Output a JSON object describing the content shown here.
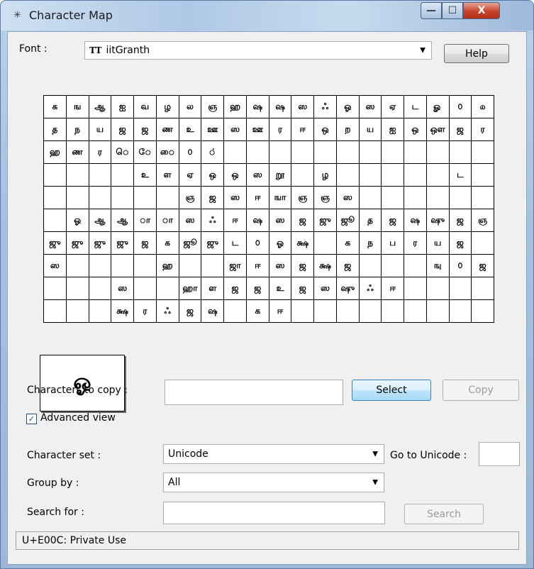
{
  "window": {
    "title": "Character Map",
    "buttons": {
      "minimize": "—",
      "maximize": "☐",
      "close": "X"
    }
  },
  "font": {
    "label": "Font :",
    "value": "iitGranth",
    "icon": "TT"
  },
  "help_label": "Help",
  "grid_rows": [
    [
      "க",
      "ங",
      "ஆ",
      "ஐ",
      "வ",
      "ழ",
      "ல",
      "ஞ",
      "ஹ",
      "ஷ",
      "ஷ",
      "ஸ",
      "ஃ",
      "ஓ",
      "ஸ",
      "ஏ",
      "ட",
      "ௐ",
      "௦",
      "௰"
    ],
    [
      "த",
      "ந",
      "ய",
      "ஜ",
      "ஜ",
      "ண",
      "உ",
      "ஊ",
      "ஸ",
      "ஊ",
      "ர",
      "ஈ",
      "ஒ",
      "ற",
      "ய",
      "ஐ",
      "ஒ",
      "ஒள",
      "ஜ",
      "ர"
    ],
    [
      "ஹ",
      "ண",
      "ர",
      "ெ",
      "ே",
      "ை",
      "௦",
      "்",
      "",
      "",
      "",
      "",
      "",
      "",
      "",
      "",
      "",
      "",
      "",
      ""
    ],
    [
      "",
      "",
      "",
      "",
      "உ",
      "ள",
      "ஏ",
      "ஒ",
      "ஒ",
      "ஸ",
      "றூ",
      "",
      "ழ",
      "",
      "",
      "",
      "",
      "",
      "ட",
      ""
    ],
    [
      "",
      "",
      "",
      "",
      "",
      "",
      "ஞ",
      "ஜ",
      "ஸ",
      "ஈ",
      "ஙா",
      "ஞ",
      "ஞ",
      "ஸ",
      "",
      "",
      "",
      "",
      "",
      ""
    ],
    [
      "",
      "ஓ",
      "ஆ",
      "ஆ",
      "ா",
      "ா",
      "ஸ",
      "ஃ",
      "ஈ",
      "ஷ",
      "ஸ",
      "ஜ",
      "ஜு",
      "ஜூ",
      "த",
      "ஜ",
      "ஷ",
      "ஷு",
      "ஜ",
      "ஞ"
    ],
    [
      "ஜு",
      "ஜு",
      "ஜு",
      "ஜு",
      "ஜ",
      "க",
      "ஜூ",
      "ஜு",
      "ட",
      "௦",
      "ஓ",
      "க்ஷ",
      "",
      "க",
      "ந",
      "ப",
      "ர",
      "ய",
      "ஜ",
      ""
    ],
    [
      "ஸ",
      "",
      "",
      "",
      "",
      "ஹ",
      "",
      "",
      "ஜா",
      "ஈ",
      "ஸ",
      "ஜ",
      "க்ஷ",
      "ஜ",
      "",
      "",
      "",
      "ஙு",
      "௦",
      "ஜ"
    ],
    [
      "",
      "",
      "",
      "ஸ",
      "",
      "",
      "ஹா",
      "ள",
      "ஜ",
      "ஜ",
      "உ",
      "ஜ",
      "ஸ",
      "ஷு",
      "ஃ",
      "ஈ",
      "",
      "",
      "",
      ""
    ],
    [
      "",
      "",
      "",
      "க்ஷ",
      "ர",
      "ஃ",
      "ஜ",
      "ஷ",
      "",
      "க",
      "ஈ",
      "",
      "",
      "",
      "",
      "",
      "",
      "",
      "",
      ""
    ]
  ],
  "magnifier_char": "ஓ",
  "chars_to_copy": {
    "label": "Characters to copy :",
    "value": ""
  },
  "select_label": "Select",
  "copy_label": "Copy",
  "advanced_view": {
    "label": "Advanced view",
    "checked": true
  },
  "charset": {
    "label": "Character set :",
    "value": "Unicode"
  },
  "goto_unicode": {
    "label": "Go to Unicode :",
    "value": ""
  },
  "group_by": {
    "label": "Group by :",
    "value": "All"
  },
  "search_for": {
    "label": "Search for :",
    "value": ""
  },
  "search_label": "Search",
  "status_text": "U+E00C: Private Use",
  "colors": {
    "accent": "#3c7fb1",
    "titlebar": "#aec8e6",
    "close": "#c7442b"
  }
}
